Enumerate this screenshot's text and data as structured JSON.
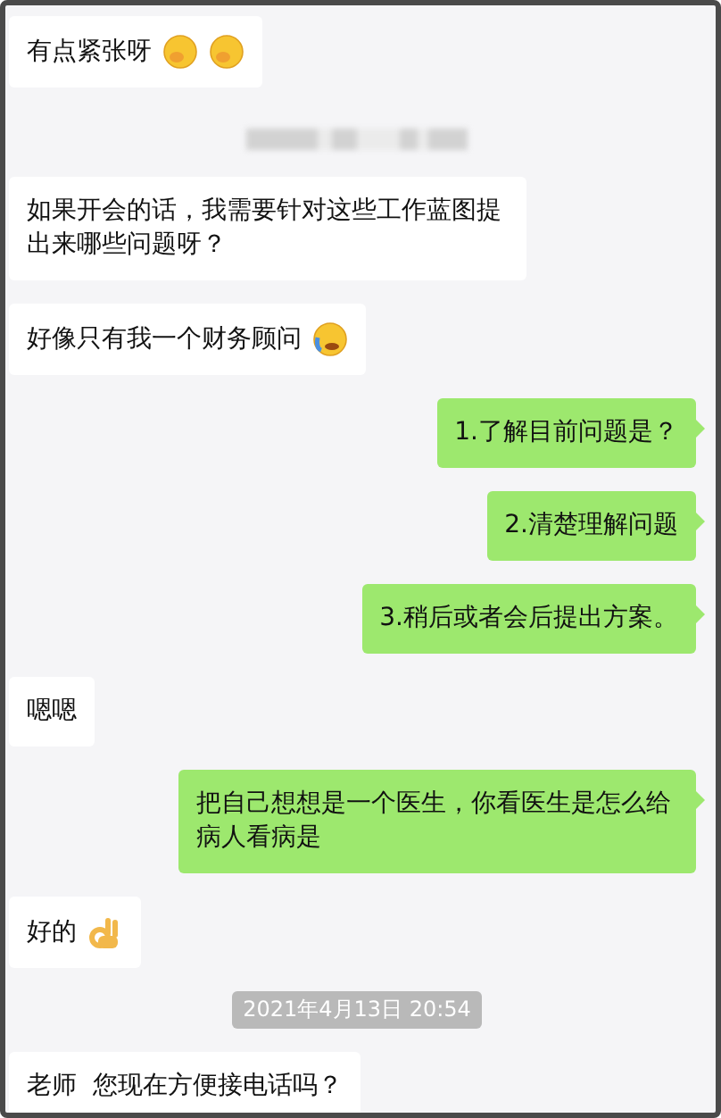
{
  "messages": [
    {
      "kind": "bubble",
      "mine": false,
      "text": "有点紧张呀",
      "emojis": [
        {
          "kind": "hand-face"
        },
        {
          "kind": "hand-face"
        }
      ]
    },
    {
      "kind": "redacted"
    },
    {
      "kind": "bubble",
      "mine": false,
      "text": "如果开会的话，我需要针对这些工作蓝图提出来哪些问题呀？"
    },
    {
      "kind": "bubble",
      "mine": false,
      "text": "好像只有我一个财务顾问",
      "emojis": [
        {
          "kind": "crying-face"
        }
      ]
    },
    {
      "kind": "bubble",
      "mine": true,
      "text": "1.了解目前问题是？"
    },
    {
      "kind": "bubble",
      "mine": true,
      "text": "2.清楚理解问题"
    },
    {
      "kind": "bubble",
      "mine": true,
      "text": "3.稍后或者会后提出方案。"
    },
    {
      "kind": "bubble",
      "mine": false,
      "text": "嗯嗯"
    },
    {
      "kind": "bubble",
      "mine": true,
      "text": "把自己想想是一个医生，你看医生是怎么给病人看病是"
    },
    {
      "kind": "bubble",
      "mine": false,
      "text": "好的",
      "emojis": [
        {
          "kind": "ok-hand"
        }
      ]
    },
    {
      "kind": "time",
      "text": "2021年4月13日 20:54"
    },
    {
      "kind": "bubble",
      "mine": false,
      "text": "老师  您现在方便接电话吗？"
    }
  ]
}
